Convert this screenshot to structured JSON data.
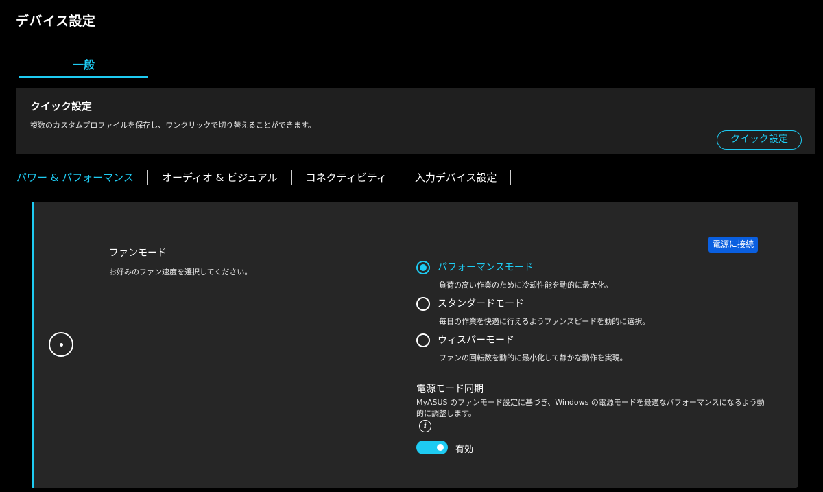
{
  "page": {
    "title": "デバイス設定"
  },
  "top_tabs": [
    {
      "label": "一般",
      "active": true
    }
  ],
  "quick_settings": {
    "title": "クイック設定",
    "description": "複数のカスタムプロファイルを保存し、ワンクリックで切り替えることができます。",
    "button_label": "クイック設定"
  },
  "sub_tabs": [
    {
      "label": "パワー & パフォーマンス",
      "active": true
    },
    {
      "label": "オーディオ & ビジュアル",
      "active": false
    },
    {
      "label": "コネクティビティ",
      "active": false
    },
    {
      "label": "入力デバイス設定",
      "active": false
    }
  ],
  "fan_mode": {
    "icon": "fan-icon",
    "title": "ファンモード",
    "description": "お好みのファン速度を選択してください。",
    "badge": "電源に接続",
    "options": [
      {
        "label": "パフォーマンスモード",
        "description": "負荷の高い作業のために冷却性能を動的に最大化。",
        "selected": true
      },
      {
        "label": "スタンダードモード",
        "description": "毎日の作業を快適に行えるようファンスピードを動的に選択。",
        "selected": false
      },
      {
        "label": "ウィスパーモード",
        "description": "ファンの回転数を動的に最小化して静かな動作を実現。",
        "selected": false
      }
    ]
  },
  "power_sync": {
    "title": "電源モード同期",
    "description": "MyASUS のファンモード設定に基づき、Windows の電源モードを最適なパフォーマンスになるよう動的に調整します。",
    "info_icon": "info-icon",
    "toggle_on": true,
    "toggle_label": "有効"
  },
  "colors": {
    "accent": "#1ecbf2",
    "badge": "#0a5fe0",
    "panel": "#262626",
    "background": "#000000"
  }
}
